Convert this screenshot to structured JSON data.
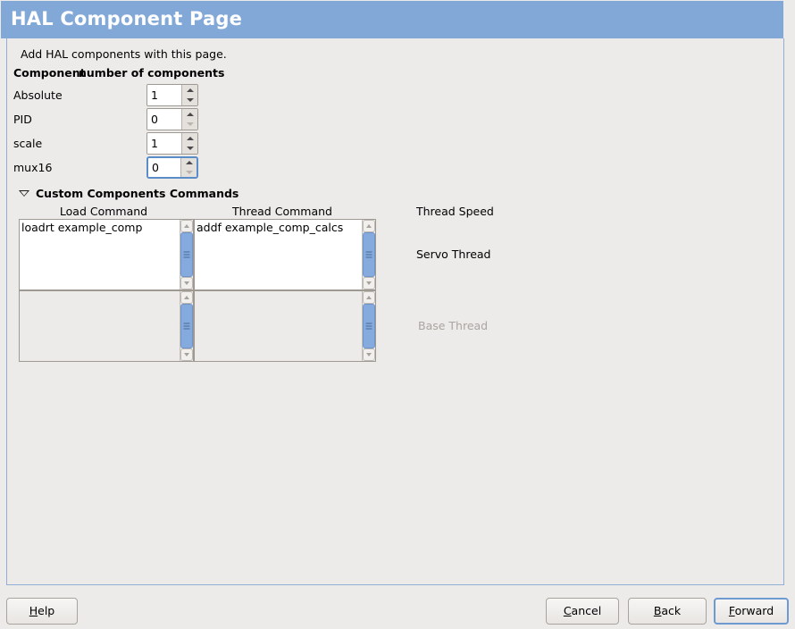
{
  "window": {
    "title": "HAL Component Page"
  },
  "intro": {
    "text": "Add HAL components with this page."
  },
  "component_table": {
    "header_component": "Component",
    "header_count": "number of components",
    "rows": [
      {
        "label": "Absolute",
        "value": "1",
        "up_enabled": true,
        "down_enabled": true,
        "focused": false
      },
      {
        "label": "PID",
        "value": "0",
        "up_enabled": true,
        "down_enabled": false,
        "focused": false
      },
      {
        "label": "scale",
        "value": "1",
        "up_enabled": true,
        "down_enabled": true,
        "focused": false
      },
      {
        "label": "mux16",
        "value": "0",
        "up_enabled": true,
        "down_enabled": false,
        "focused": true
      }
    ]
  },
  "custom_section": {
    "expander_label": "Custom Components Commands",
    "expander_icon": "triangle-down-icon",
    "expanded": true,
    "columns": {
      "load": "Load Command",
      "thread": "Thread Command",
      "speed": "Thread Speed"
    },
    "servo_row": {
      "load_command": "loadrt example_comp",
      "thread_command": "addf example_comp_calcs",
      "thread_label": "Servo Thread",
      "enabled": true
    },
    "base_row": {
      "load_command": "",
      "thread_command": "",
      "thread_label": "Base Thread",
      "enabled": false
    }
  },
  "buttons": {
    "help": {
      "mnemonic": "H",
      "rest": "elp",
      "focused": false
    },
    "cancel": {
      "mnemonic": "C",
      "rest": "ancel",
      "focused": false
    },
    "back": {
      "mnemonic": "B",
      "rest": "ack",
      "focused": false
    },
    "forward": {
      "mnemonic": "F",
      "rest": "orward",
      "focused": true
    }
  },
  "colors": {
    "header_blue": "#82a8d8",
    "panel_border": "#91aed4",
    "background": "#edebe9",
    "scroll_thumb": "#85aadd",
    "focus_border": "#5a8cc8",
    "disabled_text": "#a9a5a0"
  }
}
